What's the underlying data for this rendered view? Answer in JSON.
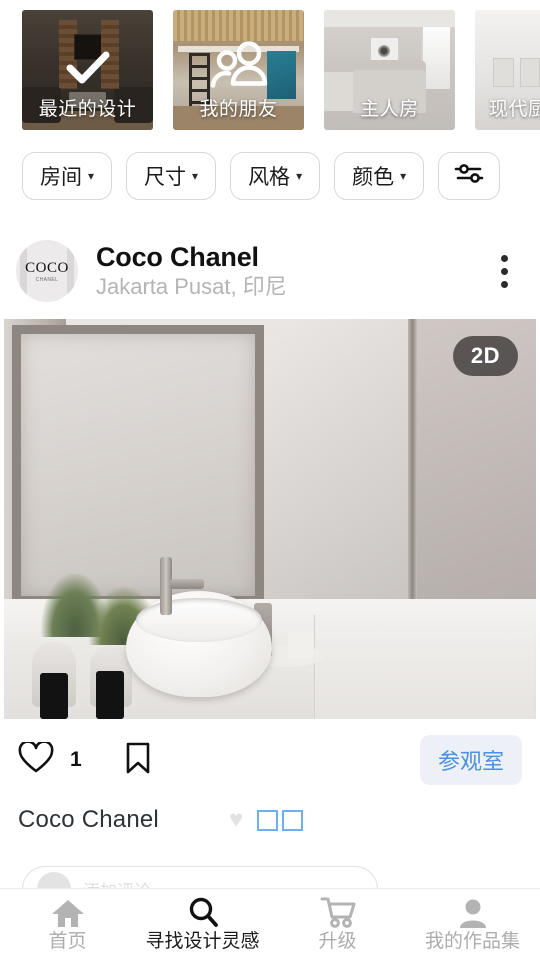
{
  "cards": [
    {
      "label": "最近的设计",
      "overlay_icon": "check-icon"
    },
    {
      "label": "我的朋友",
      "overlay_icon": "friends-group-icon"
    },
    {
      "label": "主人房",
      "overlay_icon": ""
    },
    {
      "label": "现代厨",
      "overlay_icon": ""
    }
  ],
  "filters": {
    "chips": [
      {
        "label": "房间",
        "caret": "▾"
      },
      {
        "label": "尺寸",
        "caret": "▾"
      },
      {
        "label": "风格",
        "caret": "▾"
      },
      {
        "label": "颜色",
        "caret": "▾"
      }
    ],
    "settings_icon": "sliders-icon"
  },
  "post": {
    "avatar": {
      "top_text": "COCO",
      "sub_text": "CHANEL"
    },
    "author": "Coco Chanel",
    "location": "Jakarta Pusat, 印尼",
    "menu_icon": "kebab-menu-icon",
    "badge": "2D",
    "actions": {
      "like_icon": "heart-icon",
      "like_count": "1",
      "save_icon": "bookmark-icon",
      "visit_label": "参观室"
    },
    "caption": {
      "name": "Coco Chanel",
      "emoji_heart": "♥",
      "tofu_count": 2
    },
    "comment": {
      "placeholder": "添加评论"
    }
  },
  "bottom_nav": [
    {
      "label": "首页",
      "icon": "home-icon",
      "active": false
    },
    {
      "label": "寻找设计灵感",
      "icon": "search-icon",
      "active": true
    },
    {
      "label": "升级",
      "icon": "cart-icon",
      "active": false
    },
    {
      "label": "我的作品集",
      "icon": "person-icon",
      "active": false
    }
  ],
  "colors": {
    "accent_blue": "#4a90e8",
    "visit_bg": "#edf1f7",
    "tofu_border": "#6cb0f0",
    "muted": "#b4b4b4"
  }
}
